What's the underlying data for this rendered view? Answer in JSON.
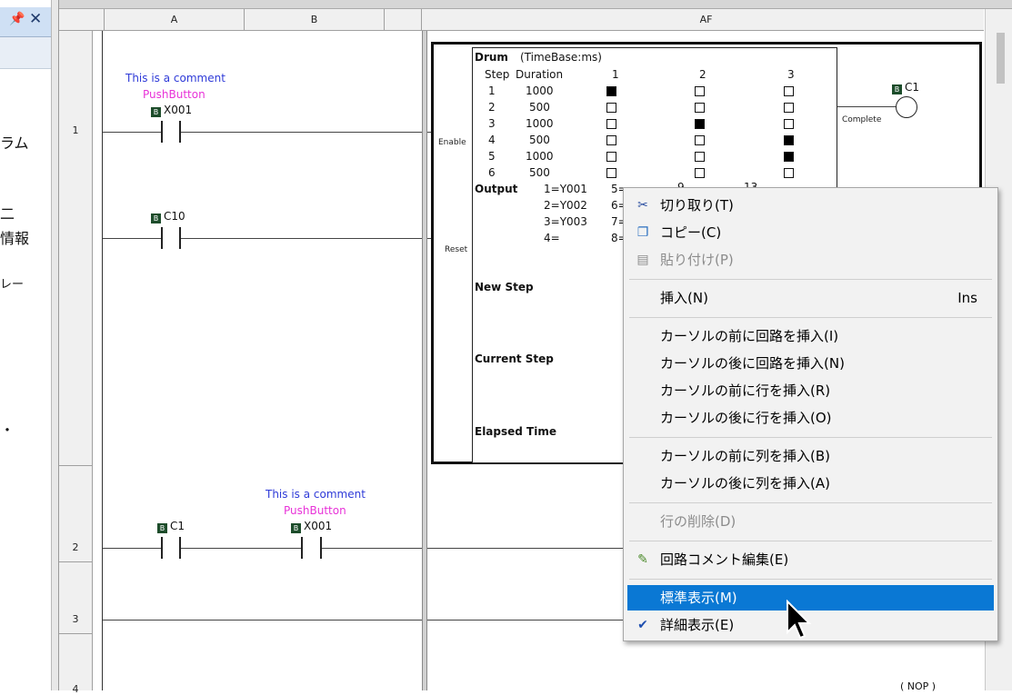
{
  "left_panel": {
    "pin": "Q",
    "close": "✕",
    "fragments": [
      "ラム",
      "二",
      "情報",
      "レー",
      "・"
    ]
  },
  "columns": [
    "A",
    "B",
    "AF"
  ],
  "rows": [
    "1",
    "2",
    "3",
    "4"
  ],
  "rung1": {
    "comment": "This is a comment",
    "comment2": "PushButton",
    "contact1": "X001",
    "contact2": "C10",
    "enable": "Enable",
    "reset": "Reset",
    "coil": "C1",
    "complete": "Complete"
  },
  "rung2": {
    "contact1": "C1",
    "comment": "This is a comment",
    "comment2": "PushButton",
    "contact2": "X001"
  },
  "drum": {
    "title": "Drum",
    "timebase": "(TimeBase:ms)",
    "step_header": "Step",
    "duration_header": "Duration",
    "col_headers": [
      "1",
      "2",
      "3"
    ],
    "steps": [
      {
        "step": "1",
        "duration": "1000",
        "cells": [
          1,
          0,
          0
        ]
      },
      {
        "step": "2",
        "duration": "500",
        "cells": [
          0,
          0,
          0
        ]
      },
      {
        "step": "3",
        "duration": "1000",
        "cells": [
          0,
          1,
          0
        ]
      },
      {
        "step": "4",
        "duration": "500",
        "cells": [
          0,
          0,
          1
        ]
      },
      {
        "step": "5",
        "duration": "1000",
        "cells": [
          0,
          0,
          1
        ]
      },
      {
        "step": "6",
        "duration": "500",
        "cells": [
          0,
          0,
          0
        ]
      }
    ],
    "output_label": "Output",
    "outputs": [
      "1=Y001",
      "2=Y002",
      "3=Y003",
      "4="
    ],
    "outputs_b": [
      "5=",
      "6=",
      "7=",
      "8="
    ],
    "out_frag1": "9",
    "out_frag2": "13",
    "new_step": "New Step",
    "current_step": "Current Step",
    "elapsed_time": "Elapsed Time"
  },
  "nop_label": "( NOP )",
  "menu": {
    "items": [
      {
        "id": "cut",
        "icon": "✂",
        "label": "切り取り(T)",
        "shortcut": "",
        "disabled": false,
        "highlighted": false,
        "checked": false
      },
      {
        "id": "copy",
        "icon": "❐",
        "label": "コピー(C)",
        "shortcut": "",
        "disabled": false,
        "highlighted": false,
        "checked": false
      },
      {
        "id": "paste",
        "icon": "▤",
        "label": "貼り付け(P)",
        "shortcut": "",
        "disabled": true,
        "highlighted": false,
        "checked": false
      },
      {
        "id": "insert",
        "icon": "",
        "label": "挿入(N)",
        "shortcut": "Ins",
        "disabled": false,
        "highlighted": false,
        "checked": false
      },
      {
        "id": "ins-rung-before",
        "icon": "",
        "label": "カーソルの前に回路を挿入(I)",
        "shortcut": "",
        "disabled": false,
        "highlighted": false,
        "checked": false
      },
      {
        "id": "ins-rung-after",
        "icon": "",
        "label": "カーソルの後に回路を挿入(N)",
        "shortcut": "",
        "disabled": false,
        "highlighted": false,
        "checked": false
      },
      {
        "id": "ins-row-before",
        "icon": "",
        "label": "カーソルの前に行を挿入(R)",
        "shortcut": "",
        "disabled": false,
        "highlighted": false,
        "checked": false
      },
      {
        "id": "ins-row-after",
        "icon": "",
        "label": "カーソルの後に行を挿入(O)",
        "shortcut": "",
        "disabled": false,
        "highlighted": false,
        "checked": false
      },
      {
        "id": "ins-col-before",
        "icon": "",
        "label": "カーソルの前に列を挿入(B)",
        "shortcut": "",
        "disabled": false,
        "highlighted": false,
        "checked": false
      },
      {
        "id": "ins-col-after",
        "icon": "",
        "label": "カーソルの後に列を挿入(A)",
        "shortcut": "",
        "disabled": false,
        "highlighted": false,
        "checked": false
      },
      {
        "id": "delete-row",
        "icon": "",
        "label": "行の削除(D)",
        "shortcut": "",
        "disabled": true,
        "highlighted": false,
        "checked": false
      },
      {
        "id": "edit-comment",
        "icon": "✎",
        "label": "回路コメント編集(E)",
        "shortcut": "",
        "disabled": false,
        "highlighted": false,
        "checked": false
      },
      {
        "id": "standard-view",
        "icon": "",
        "label": "標準表示(M)",
        "shortcut": "",
        "disabled": false,
        "highlighted": true,
        "checked": false
      },
      {
        "id": "detail-view",
        "icon": "✔",
        "label": "詳細表示(E)",
        "shortcut": "",
        "disabled": false,
        "highlighted": false,
        "checked": true
      }
    ]
  },
  "colors": {
    "highlight": "#0a78d4",
    "comment_blue": "#2f3bd8",
    "comment_pink": "#e832d8"
  }
}
